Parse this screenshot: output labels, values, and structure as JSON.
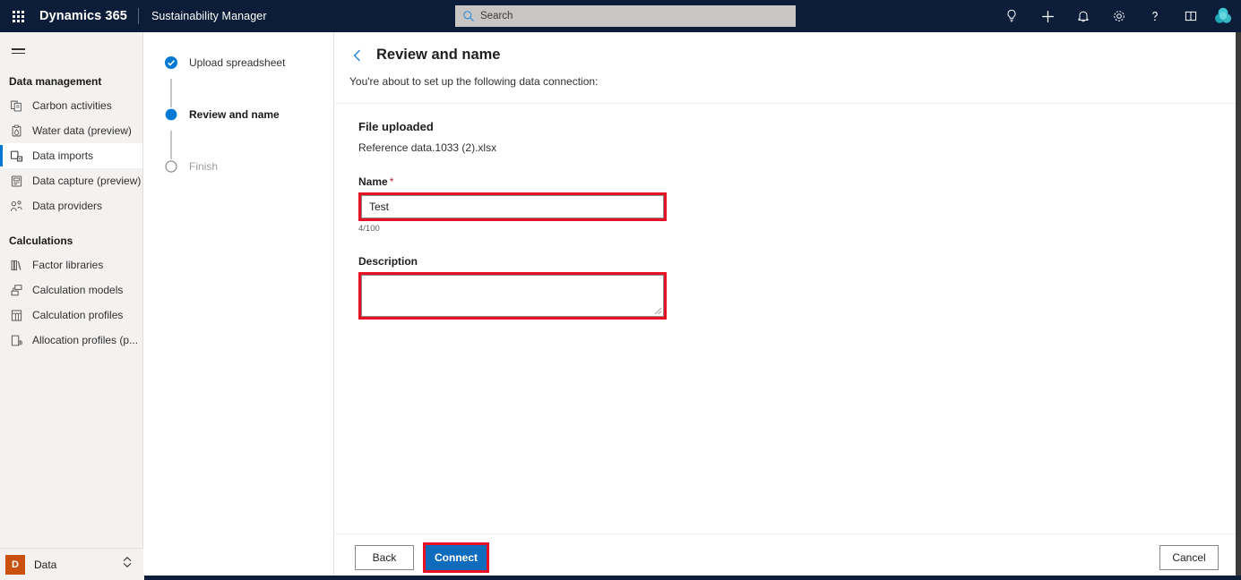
{
  "topbar": {
    "waffle_label": "app-launcher",
    "brand": "Dynamics 365",
    "app_name": "Sustainability Manager",
    "search_placeholder": "Search",
    "search_value": "",
    "icons": [
      {
        "name": "lightbulb-icon",
        "label": "Ideas"
      },
      {
        "name": "plus-icon",
        "label": "New"
      },
      {
        "name": "bell-icon",
        "label": "Notifications"
      },
      {
        "name": "gear-icon",
        "label": "Settings"
      },
      {
        "name": "question-icon",
        "label": "Help"
      },
      {
        "name": "guide-icon",
        "label": "Guides"
      }
    ],
    "avatar_label": "User account",
    "brand_bg": "#0b1d39"
  },
  "sidebar": {
    "hamburger_label": "Collapse navigation",
    "groups": [
      {
        "title": "Data management",
        "items": [
          {
            "label": "Carbon activities",
            "icon": "carbon-activities-icon",
            "selected": false
          },
          {
            "label": "Water data (preview)",
            "icon": "water-data-icon",
            "selected": false
          },
          {
            "label": "Data imports",
            "icon": "data-imports-icon",
            "selected": true
          },
          {
            "label": "Data capture (preview)",
            "icon": "data-capture-icon",
            "selected": false
          },
          {
            "label": "Data providers",
            "icon": "data-providers-icon",
            "selected": false
          }
        ]
      },
      {
        "title": "Calculations",
        "items": [
          {
            "label": "Factor libraries",
            "icon": "factor-libraries-icon",
            "selected": false
          },
          {
            "label": "Calculation models",
            "icon": "calculation-models-icon",
            "selected": false
          },
          {
            "label": "Calculation profiles",
            "icon": "calculation-profiles-icon",
            "selected": false
          },
          {
            "label": "Allocation profiles (p...",
            "icon": "allocation-profiles-icon",
            "selected": false
          }
        ]
      }
    ],
    "area_switcher": {
      "badge": "D",
      "label": "Data",
      "accent": "#ca5010"
    }
  },
  "wizard": {
    "steps": [
      {
        "label": "Upload spreadsheet",
        "state": "done"
      },
      {
        "label": "Review and name",
        "state": "current"
      },
      {
        "label": "Finish",
        "state": "todo"
      }
    ],
    "accent": "#0078d4"
  },
  "main": {
    "back_label": "Back",
    "title": "Review and name",
    "subtitle": "You're about to set up the following data connection:",
    "file_section_heading": "File uploaded",
    "file_name": "Reference data.1033 (2).xlsx",
    "name_label": "Name",
    "name_required_mark": "*",
    "name_value": "Test",
    "name_placeholder": "",
    "name_counter": "4/100",
    "description_label": "Description",
    "description_value": "",
    "description_placeholder": "",
    "highlight_color": "#e81123"
  },
  "footer": {
    "back": "Back",
    "connect": "Connect",
    "cancel": "Cancel",
    "primary_color": "#0f6cbd"
  }
}
